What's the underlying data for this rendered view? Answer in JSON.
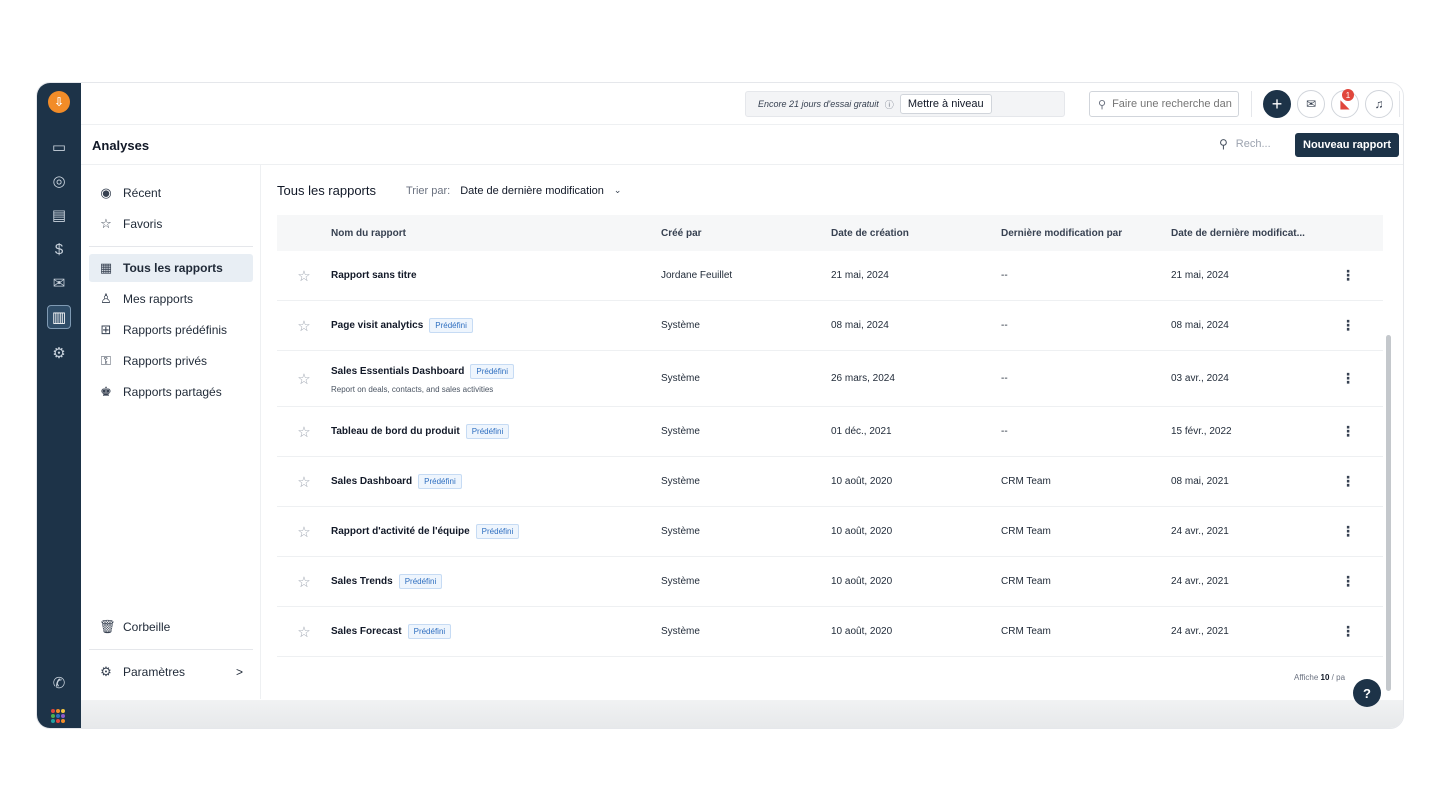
{
  "trial": {
    "text": "Encore 21 jours d'essai gratuit",
    "info_icon": "info-icon",
    "upgrade_label": "Mettre à niveau"
  },
  "global_search": {
    "placeholder": "Faire une recherche dans"
  },
  "notifications_count": "1",
  "avatar_initial": "J",
  "header": {
    "title": "Analyses",
    "search_placeholder": "Rech...",
    "new_report_label": "Nouveau rapport"
  },
  "sidebar": {
    "items": [
      {
        "label": "Récent",
        "icon": "play-circle-icon"
      },
      {
        "label": "Favoris",
        "icon": "star-icon"
      },
      {
        "label": "Tous les rapports",
        "icon": "reports-icon"
      },
      {
        "label": "Mes rapports",
        "icon": "user-icon"
      },
      {
        "label": "Rapports prédéfinis",
        "icon": "grid-icon"
      },
      {
        "label": "Rapports privés",
        "icon": "lock-icon"
      },
      {
        "label": "Rapports partagés",
        "icon": "users-icon"
      }
    ],
    "trash_label": "Corbeille",
    "settings_label": "Paramètres",
    "settings_chevron": ">"
  },
  "main": {
    "title": "Tous les rapports",
    "sort_label": "Trier par:",
    "sort_value": "Date de dernière modification",
    "sort_chevron": "⌄"
  },
  "table": {
    "columns": [
      "Nom du rapport",
      "Créé par",
      "Date de création",
      "Dernière modification par",
      "Date de dernière modificat..."
    ],
    "rows": [
      {
        "name": "Rapport sans titre",
        "tag": "",
        "desc": "",
        "created_by": "Jordane Feuillet",
        "created": "21 mai, 2024",
        "modified_by": "--",
        "modified": "21 mai, 2024"
      },
      {
        "name": "Page visit analytics",
        "tag": "Prédéfini",
        "desc": "",
        "created_by": "Système",
        "created": "08 mai, 2024",
        "modified_by": "--",
        "modified": "08 mai, 2024"
      },
      {
        "name": "Sales Essentials Dashboard",
        "tag": "Prédéfini",
        "desc": "Report on deals, contacts, and sales activities",
        "created_by": "Système",
        "created": "26 mars, 2024",
        "modified_by": "--",
        "modified": "03 avr., 2024"
      },
      {
        "name": "Tableau de bord du produit",
        "tag": "Prédéfini",
        "desc": "",
        "created_by": "Système",
        "created": "01 déc., 2021",
        "modified_by": "--",
        "modified": "15 févr., 2022"
      },
      {
        "name": "Sales Dashboard",
        "tag": "Prédéfini",
        "desc": "",
        "created_by": "Système",
        "created": "10 août, 2020",
        "modified_by": "CRM Team",
        "modified": "08 mai, 2021"
      },
      {
        "name": "Rapport d'activité de l'équipe",
        "tag": "Prédéfini",
        "desc": "",
        "created_by": "Système",
        "created": "10 août, 2020",
        "modified_by": "CRM Team",
        "modified": "24 avr., 2021"
      },
      {
        "name": "Sales Trends",
        "tag": "Prédéfini",
        "desc": "",
        "created_by": "Système",
        "created": "10 août, 2020",
        "modified_by": "CRM Team",
        "modified": "24 avr., 2021"
      },
      {
        "name": "Sales Forecast",
        "tag": "Prédéfini",
        "desc": "",
        "created_by": "Système",
        "created": "10 août, 2020",
        "modified_by": "CRM Team",
        "modified": "24 avr., 2021"
      }
    ]
  },
  "footer": {
    "count_prefix": "Affiche ",
    "count_value": "10",
    "count_suffix": " / pa"
  },
  "help_label": "?",
  "colors": {
    "rail": "#1d3348",
    "accent_logo": "#f28c28",
    "tag_blue": "#2f6fc0",
    "badge_red": "#e0463c"
  }
}
